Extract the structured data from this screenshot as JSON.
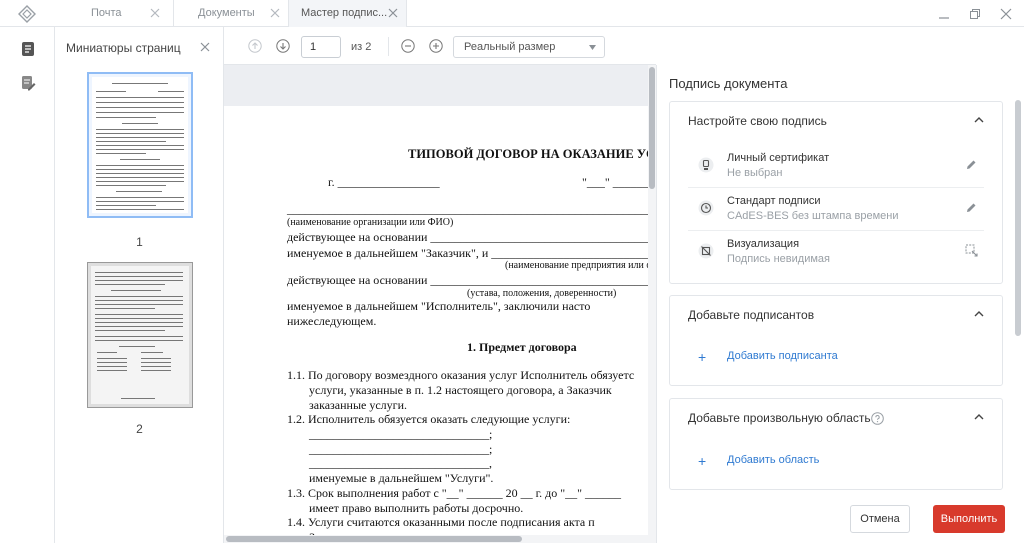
{
  "tabs": [
    {
      "label": "Почта"
    },
    {
      "label": "Документы"
    },
    {
      "label": "Мастер подпис..."
    }
  ],
  "thumbnails": {
    "title": "Миниатюры страниц",
    "pages": [
      {
        "number": "1"
      },
      {
        "number": "2"
      }
    ]
  },
  "viewer": {
    "page_value": "1",
    "page_count_label": "из 2",
    "zoom_label": "Реальный размер"
  },
  "document": {
    "title": "ТИПОВОЙ ДОГОВОР НА ОКАЗАНИЕ УС",
    "city_line": "г. _________________",
    "date_line": "\"___\" ______",
    "blank_long": "_____________________________________________________________",
    "org_caption": "(наименование организации или ФИО)",
    "basis_line": "действующее на основании __________________________________________",
    "customer_line": "именуемое в дальнейшем \"Заказчик\", и _______________________________",
    "ent_caption": "(наименование предприятия или ф",
    "basis_line_2": "действующее на основании ____________________________________________",
    "charter_caption": "(устава, положения, доверенности)",
    "executor_line": "именуемое   в   дальнейшем   \"Исполнитель\",   заключили   насто",
    "executor_line_2": "нижеследующем.",
    "section_title": "1. Предмет договора",
    "p11_a": "1.1. По договору возмездного оказания услуг Исполнитель обязуетс",
    "p11_b": "услуги, указанные в п. 1.2 настоящего договора, а Заказчик",
    "p11_c": "заказанные услуги.",
    "p12": "1.2. Исполнитель обязуется оказать следующие услуги:",
    "blank_item_1": "______________________________;",
    "blank_item_2": "______________________________;",
    "blank_item_3": "______________________________,",
    "services_named": "именуемые в дальнейшем \"Услуги\".",
    "p13_a": "1.3. Срок выполнения работ с \"__\" ______ 20 __ г. до \"__\" ______",
    "p13_b": "имеет право выполнить работы досрочно.",
    "p14_a": "1.4. Услуги считаются оказанными после подписания акта п",
    "p14_b": "Заказчиком или его уполномоченным представителем."
  },
  "signature_panel": {
    "title": "Подпись документа",
    "configure": {
      "title": "Настройте свою подпись",
      "options": [
        {
          "title": "Личный сертификат",
          "value": "Не выбран",
          "icon": "certificate-icon"
        },
        {
          "title": "Стандарт подписи",
          "value": "CAdES-BES без штампа времени",
          "icon": "clock-icon"
        },
        {
          "title": "Визуализация",
          "value": "Подпись невидимая",
          "icon": "visualization-off-icon"
        }
      ]
    },
    "signers": {
      "title": "Добавьте подписантов",
      "add_label": "Добавить подписанта"
    },
    "area": {
      "title": "Добавьте произвольную область",
      "add_label": "Добавить область"
    },
    "cancel_label": "Отмена",
    "submit_label": "Выполнить"
  },
  "colors": {
    "accent": "#2f7ad1",
    "primary_button": "#d83a2c"
  }
}
